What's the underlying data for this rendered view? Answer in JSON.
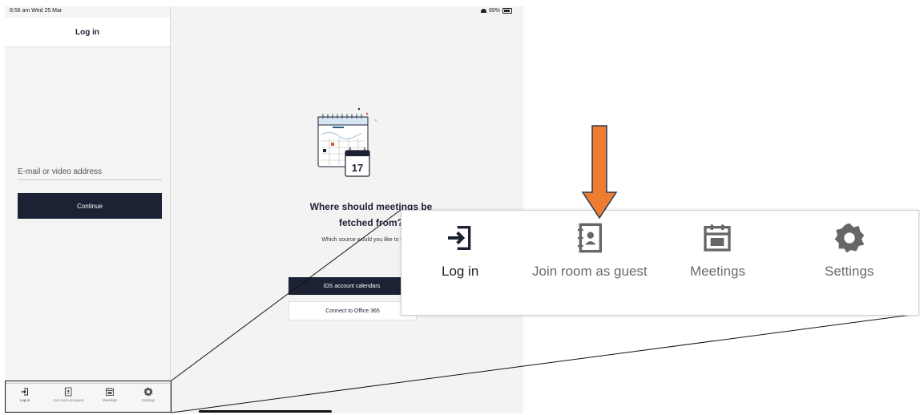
{
  "status_bar": {
    "time": "8:56 am  Wed 25 Mar",
    "battery": "89%"
  },
  "sidebar": {
    "title": "Log in",
    "email_placeholder": "E-mail or video address",
    "continue_label": "Continue"
  },
  "tabs": [
    {
      "label": "Log in",
      "icon": "login-icon"
    },
    {
      "label": "Join room as guest",
      "icon": "contact-book-icon"
    },
    {
      "label": "Meetings",
      "icon": "calendar-icon"
    },
    {
      "label": "Settings",
      "icon": "gear-icon"
    }
  ],
  "main": {
    "calendar_day": "17",
    "question_line1": "Where should meetings be",
    "question_line2": "fetched from?",
    "subtitle": "Which source would you like to use?",
    "ios_button": "iOS account calendars",
    "office_button": "Connect to Office 365"
  },
  "annotation": {
    "arrow_color": "#ed7d31",
    "highlighted_tab": "Join room as guest"
  }
}
